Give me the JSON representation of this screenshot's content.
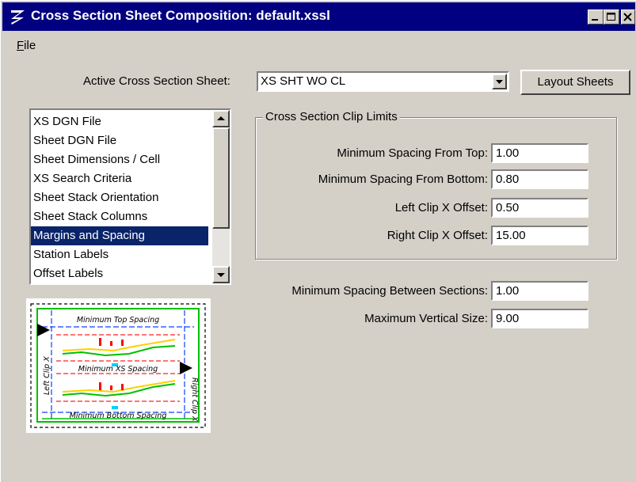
{
  "window": {
    "title": "Cross Section Sheet Composition: default.xssl",
    "minimize_icon": "minimize-icon",
    "maximize_icon": "maximize-icon",
    "close_icon": "close-icon"
  },
  "menu": {
    "file_hotkey": "F",
    "file_rest": "ile"
  },
  "active_sheet": {
    "label": "Active Cross Section Sheet:",
    "value": "XS SHT WO CL",
    "layout_button": "Layout Sheets"
  },
  "category_list": {
    "items": [
      "XS DGN File",
      "Sheet DGN File",
      "Sheet Dimensions / Cell",
      "XS Search Criteria",
      "Sheet Stack Orientation",
      "Sheet Stack Columns",
      "Margins and Spacing",
      "Station Labels",
      "Offset Labels"
    ],
    "selected": "Margins and Spacing"
  },
  "clip_limits": {
    "group_title": "Cross Section Clip Limits",
    "fields": [
      {
        "label": "Minimum Spacing From Top:",
        "value": "1.00"
      },
      {
        "label": "Minimum Spacing From Bottom:",
        "value": "0.80"
      },
      {
        "label": "Left Clip X Offset:",
        "value": "0.50"
      },
      {
        "label": "Right Clip X Offset:",
        "value": "15.00"
      }
    ]
  },
  "spacing": {
    "fields": [
      {
        "label": "Minimum Spacing Between Sections:",
        "value": "1.00"
      },
      {
        "label": "Maximum Vertical Size:",
        "value": "9.00"
      }
    ]
  },
  "preview": {
    "top_label": "Minimum Top Spacing",
    "middle_label": "Minimum XS Spacing",
    "bottom_label": "Minimum Bottom Spacing",
    "left_label": "Left Clip X",
    "right_label": "Right Clip X"
  },
  "colors": {
    "title_bar": "#000080",
    "selection": "#0a246a",
    "face": "#d4d0c8"
  }
}
